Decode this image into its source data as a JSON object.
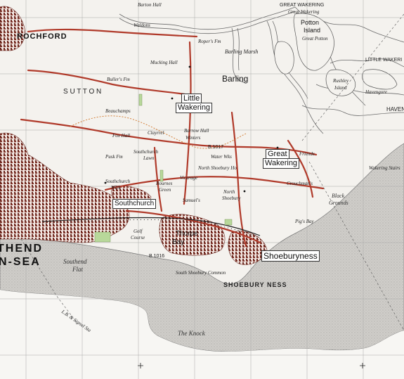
{
  "map": {
    "colors": {
      "land": "#f4f2ee",
      "sea": "#c8c6c2",
      "river": "#dcdad5",
      "road": "#b03a2a",
      "urban": "#7a2f25",
      "grid": "#9a9a9a",
      "text": "#1a1a1a",
      "dashed_path": "#d4803a",
      "park": "#b8d89a"
    },
    "labels": {
      "rochford": "ROCHFORD",
      "southend_1": "THEND",
      "southend_2": "N-SEA",
      "southend_flat_1": "Southend",
      "southend_flat_2": "Flat",
      "southchurch": "Southchurch",
      "thorpe_bay_1": "Thorpe",
      "thorpe_bay_2": "Bay",
      "shoeburyness": "Shoeburyness",
      "shoebury_ness": "SHOEBURY NESS",
      "south_shoebury": "South Shoebury Common",
      "little_wakering_1": "Little",
      "little_wakering_2": "Wakering",
      "great_wakering_1": "Great",
      "great_wakering_2": "Wakering",
      "barling": "Barling",
      "barling_marsh": "Barling Marsh",
      "sutton": "S  U  T  T  O  N",
      "the_knock": "The Knock",
      "pigs_bay": "Pig's Bay",
      "black_grounds_1": "Black",
      "black_grounds_2": "Grounds",
      "potton_island_1": "Potton",
      "potton_island_2": "Island",
      "great_potton": "Great Potton",
      "rushley_island_1": "Rushley",
      "rushley_island_2": "Island",
      "havengore": "Havengore",
      "haven": "HAVEN",
      "little_wakering_top": "LITTLE WAKERI",
      "great_wakering_top": "GREAT WAKERING",
      "wakering_stairs": "Wakering Stairs",
      "crouchmans": "Crouchman's",
      "north_shoebury_1": "North",
      "north_shoebury_2": "Shoebury",
      "north_shoebury_ho": "North Shoebury Ho",
      "vicarage": "Vicarage",
      "bournes_green_1": "Bournes",
      "bournes_green_2": "Green",
      "southchurch_lawn_1": "Southchurch",
      "southchurch_lawn_2": "Lawn",
      "southchurch_wick_1": "Southchurch",
      "southchurch_wick_2": "Wick",
      "golf_course_1": "Golf",
      "golf_course_2": "Course",
      "barrow_hall": "Barrow Hall",
      "winters": "Winters",
      "clayrrel": "Clayrrel",
      "beauchamps": "Beauchamps",
      "fox_hall": "Fox Hall",
      "mucking_hall": "Mucking Hall",
      "barton_hall": "Barton Hall",
      "waldons": "Waldons",
      "ropers": "Roper's Fm",
      "bullers": "Buller's Fm",
      "samuels": "Samuel's",
      "road_b1017": "B.1017",
      "road_b1016": "B.1016",
      "friends": "Friends",
      "water_works": "Water Wks",
      "pusk": "Pusk Fm",
      "great_wakering_creek": "Great Wakering",
      "la_signal": "L.B. & Signal Sta"
    }
  }
}
